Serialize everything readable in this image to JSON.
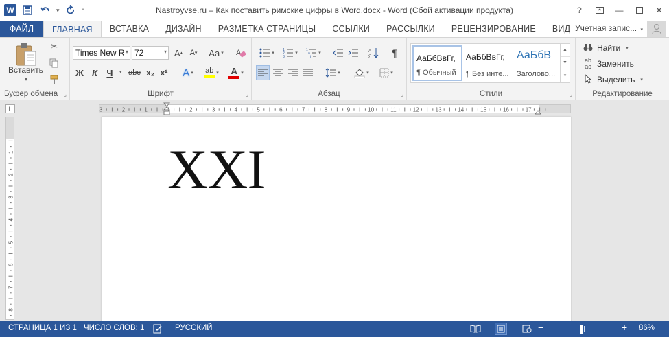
{
  "title_bar": {
    "title": "Nastroyvse.ru – Как поставить римские цифры в Word.docx - Word (Сбой активации продукта)",
    "app_logo": "W",
    "icons": [
      "word-logo-icon",
      "save-icon",
      "undo-icon",
      "redo-icon",
      "customize-icon",
      "help-icon",
      "ribbon-display-icon",
      "minimize-icon",
      "maximize-icon",
      "close-icon"
    ]
  },
  "tabs": {
    "file": "ФАЙЛ",
    "home": "ГЛАВНАЯ",
    "insert": "ВСТАВКА",
    "design": "ДИЗАЙН",
    "layout": "РАЗМЕТКА СТРАНИЦЫ",
    "references": "ССЫЛКИ",
    "mailings": "РАССЫЛКИ",
    "review": "РЕЦЕНЗИРОВАНИЕ",
    "view": "ВИД",
    "account": "Учетная запис..."
  },
  "ribbon": {
    "clipboard": {
      "label": "Буфер обмена",
      "paste": "Вставить"
    },
    "font": {
      "label": "Шрифт",
      "font_name": "Times New R",
      "font_size": "72",
      "bold": "Ж",
      "italic": "К",
      "underline": "Ч",
      "strike": "abc",
      "subscript": "x₂",
      "superscript": "x²",
      "grow": "A",
      "shrink": "A",
      "change_case": "Aa",
      "effects": "A",
      "highlight": "ab",
      "font_color": "A"
    },
    "paragraph": {
      "label": "Абзац"
    },
    "styles": {
      "label": "Стили",
      "items": [
        {
          "sample": "АаБбВвГг,",
          "name": "¶ Обычный"
        },
        {
          "sample": "АаБбВвГг,",
          "name": "¶ Без инте..."
        },
        {
          "sample": "АаБбВ",
          "name": "Заголово..."
        }
      ]
    },
    "editing": {
      "label": "Редактирование",
      "find": "Найти",
      "replace": "Заменить",
      "select": "Выделить"
    }
  },
  "ruler": {
    "corner": "L",
    "ticks": [
      "3",
      "2",
      "1",
      "1",
      "2",
      "3",
      "4",
      "5",
      "6",
      "7",
      "8",
      "9",
      "10",
      "11",
      "12",
      "13",
      "14",
      "15",
      "16",
      "17"
    ]
  },
  "document": {
    "text": "XXI"
  },
  "status_bar": {
    "page": "СТРАНИЦА 1 ИЗ 1",
    "words": "ЧИСЛО СЛОВ: 1",
    "language": "РУССКИЙ",
    "zoom_minus": "−",
    "zoom_plus": "+",
    "zoom": "86%",
    "zoom_percent": 86
  },
  "colors": {
    "accent": "#2b579a",
    "ribbon_bg": "#f3f3f3",
    "heading_blue": "#2e74b5",
    "highlight_yellow": "#ffff00",
    "font_red": "#e00000"
  }
}
